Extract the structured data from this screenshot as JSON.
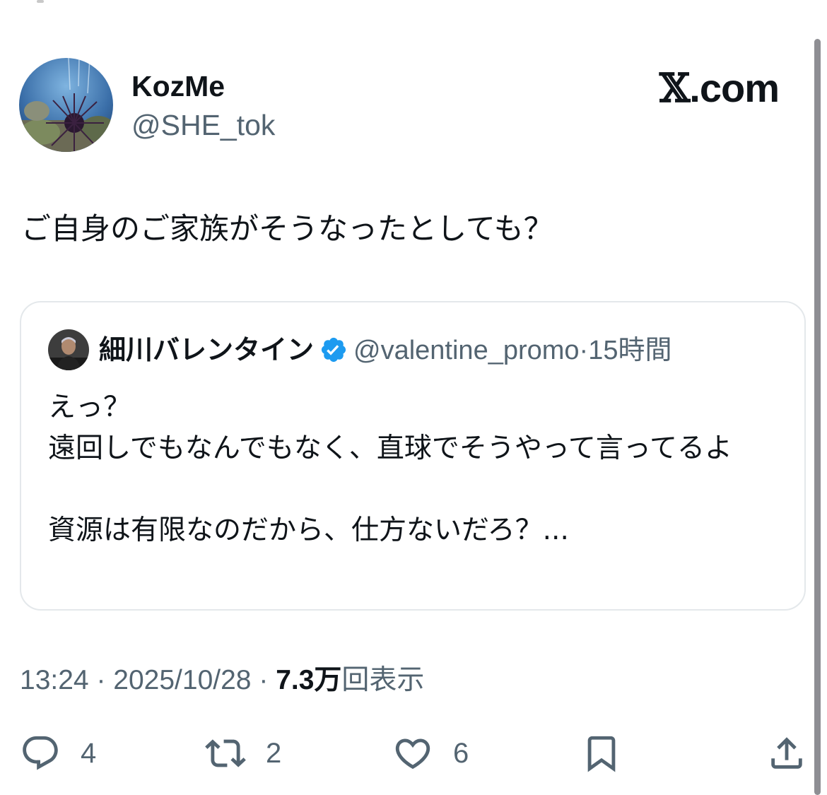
{
  "author": {
    "display_name": "KozMe",
    "handle": "@SHE_tok"
  },
  "brand": {
    "x_glyph": "𝕏",
    "domain": ".com"
  },
  "tweet": {
    "text": "ご自身のご家族がそうなったとしても？"
  },
  "quote": {
    "display_name": "細川バレンタイン",
    "handle": "@valentine_promo",
    "separator": "·",
    "time": "15時間",
    "text": "えっ？\n遠回しでもなんでもなく、直球でそうやって言ってるよ\n\n資源は有限なのだから、仕方ないだろ？...",
    "verified_color": "#1d9bf0"
  },
  "meta": {
    "time": "13:24",
    "date": "2025/10/28",
    "views_count": "7.3万",
    "views_label": "回表示",
    "separator": "·"
  },
  "actions": {
    "replies": "4",
    "reposts": "2",
    "likes": "6"
  },
  "icons": [
    "reply-icon",
    "repost-icon",
    "like-icon",
    "bookmark-icon",
    "share-icon",
    "verified-badge-icon"
  ]
}
